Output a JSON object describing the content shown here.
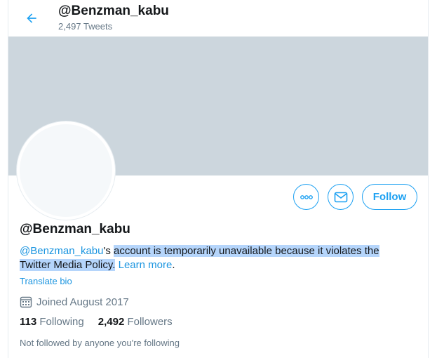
{
  "header": {
    "title": "@Benzman_kabu",
    "tweet_count": "2,497 Tweets"
  },
  "actions": {
    "follow_label": "Follow"
  },
  "profile": {
    "name": "@Benzman_kabu",
    "bio": {
      "handle_link": "@Benzman_kabu",
      "possessive": "'s ",
      "message_line1": "account is temporarily unavailable because it violates the",
      "message_line2": "Twitter Media Policy.",
      "learn_more": "Learn more",
      "period": "."
    },
    "translate_label": "Translate bio",
    "joined": "Joined August 2017",
    "following_count": "113",
    "following_label": "Following",
    "followers_count": "2,492",
    "followers_label": "Followers",
    "not_followed_text": "Not followed by anyone you're following"
  },
  "colors": {
    "accent": "#1da1f2",
    "banner": "#ccd6dd",
    "selection_highlight": "#b5d5fb"
  }
}
